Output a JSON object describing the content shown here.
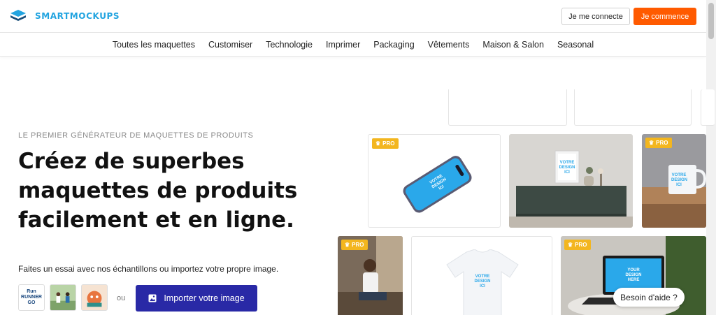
{
  "header": {
    "logo_text": "SMARTMOCKUPS",
    "login_label": "Je me connecte",
    "start_label": "Je commence"
  },
  "nav": {
    "items": [
      "Toutes les maquettes",
      "Customiser",
      "Technologie",
      "Imprimer",
      "Packaging",
      "Vêtements",
      "Maison & Salon",
      "Seasonal"
    ]
  },
  "hero": {
    "eyebrow": "LE PREMIER GÉNÉRATEUR DE MAQUETTES DE PRODUITS",
    "headline": "Créez de superbes maquettes de produits facilement et en ligne.",
    "subtext": "Faites un essai avec nos échantillons ou importez votre propre image.",
    "sample_1_text": "Run RUNNER GO",
    "or_text": "ou",
    "import_label": "Importer votre image"
  },
  "cards": {
    "pro_badge": "PRO",
    "design_text": "VOTRE DESIGN ICI",
    "design_text_en": "YOUR DESIGN HERE"
  },
  "help": {
    "label": "Besoin d'aide ?"
  },
  "colors": {
    "brand": "#22a4e0",
    "cta": "#ff5a00",
    "import": "#2929a6",
    "pro": "#f3b61f"
  }
}
